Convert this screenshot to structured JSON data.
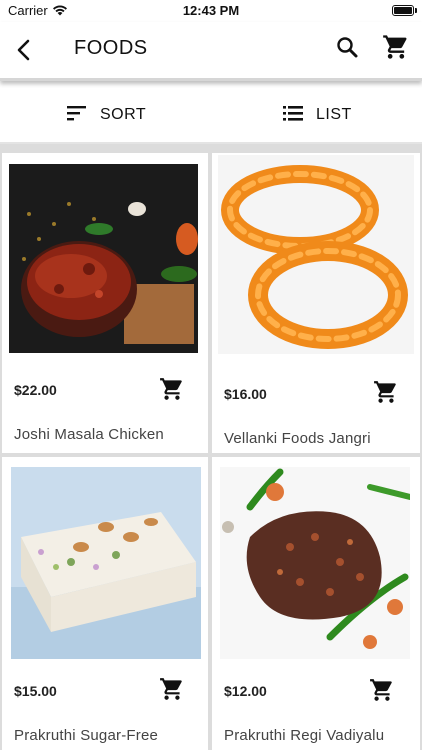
{
  "status": {
    "carrier": "Carrier",
    "time": "12:43 PM"
  },
  "header": {
    "title": "FOODS"
  },
  "toolbar": {
    "sort_label": "SORT",
    "list_label": "LIST"
  },
  "products": [
    {
      "name": "Joshi Masala Chicken",
      "price": "$22.00",
      "image": "masala-chicken-photo"
    },
    {
      "name": "Vellanki Foods Jangri",
      "price": "$16.00",
      "image": "jangri-photo"
    },
    {
      "name": "Prakruthi Sugar-Free",
      "price": "$15.00",
      "image": "sugar-free-sweet-photo"
    },
    {
      "name": "Prakruthi Regi Vadiyalu",
      "price": "$12.00",
      "image": "regi-vadiyalu-photo"
    }
  ],
  "colors": {
    "accent": "#111111",
    "divider": "#dcdcdc",
    "text_muted": "#444444"
  }
}
